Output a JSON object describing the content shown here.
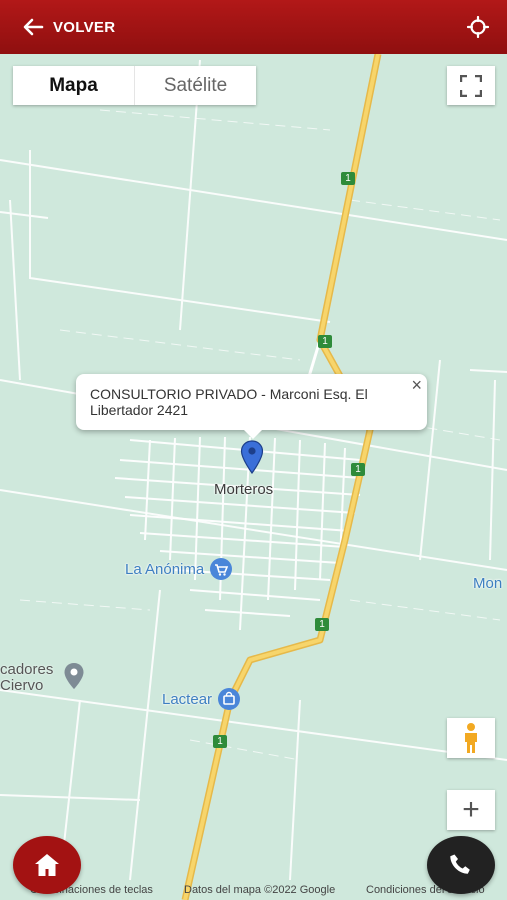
{
  "header": {
    "back_label": "VOLVER",
    "back_icon": "arrow-left-icon",
    "locate_icon": "crosshair-icon",
    "colors": {
      "bar": "#a31212"
    }
  },
  "map_type": {
    "options": [
      "Mapa",
      "Satélite"
    ],
    "selected": "Mapa"
  },
  "info_window": {
    "text": "CONSULTORIO PRIVADO - Marconi Esq. El Libertador 2421",
    "close": "×"
  },
  "places": {
    "town": "Morteros",
    "poi_store": "La Anónima",
    "poi_dairy": "Lactear",
    "poi_partial_left": "cadores\nCiervo",
    "poi_partial_right": "Mon"
  },
  "road_shields": [
    "1",
    "1",
    "1",
    "1",
    "1"
  ],
  "controls": {
    "fullscreen_icon": "fullscreen-icon",
    "pegman_icon": "pegman-icon",
    "zoom_in": "+",
    "home_icon": "home-icon",
    "phone_icon": "phone-icon"
  },
  "footer": {
    "shortcuts": "Combinaciones de teclas",
    "attribution": "Datos del mapa ©2022 Google",
    "terms": "Condiciones del servicio"
  },
  "colors": {
    "map_bg": "#cfe8dc",
    "road": "#f2c94c",
    "fab_home": "#a31212",
    "fab_phone": "#222222",
    "poi_blue": "#3e7fc1"
  }
}
